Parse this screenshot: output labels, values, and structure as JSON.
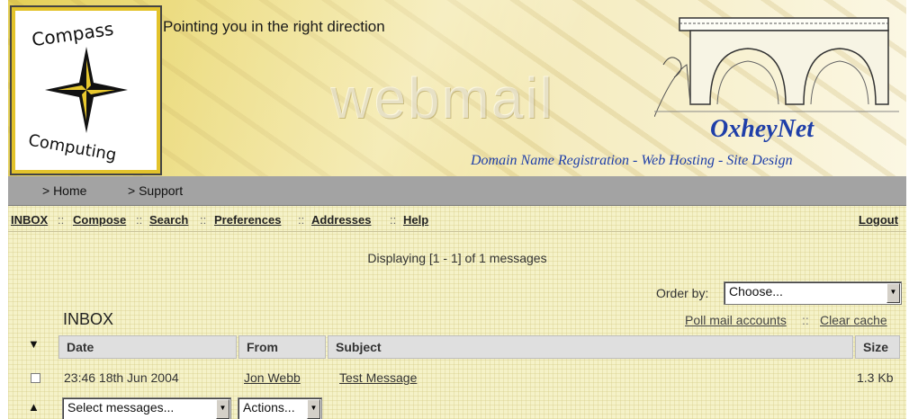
{
  "header": {
    "logo_line1": "Compass",
    "logo_line2": "Computing",
    "tagline": "Pointing you in the right direction",
    "watermark": "webmail",
    "brand_name": "OxheyNet",
    "brand_services": "Domain Name Registration - Web Hosting - Site Design",
    "colors": {
      "banner": "#e9d770",
      "brand_blue": "#1f3fa8",
      "logo_border": "#e3c32b"
    }
  },
  "topnav": {
    "items": [
      "> Home",
      "> Support"
    ]
  },
  "menu": {
    "items": [
      "INBOX",
      "Compose",
      "Search",
      "Preferences",
      "Addresses",
      "Help"
    ],
    "separator": "::",
    "logout": "Logout"
  },
  "mailbox": {
    "status": "Displaying [1 - 1] of 1 messages",
    "order_label": "Order by:",
    "order_value": "Choose...",
    "title": "INBOX",
    "poll_link": "Poll mail accounts",
    "clear_cache_link": "Clear cache",
    "separator": "::",
    "sort_icon_top": "▼",
    "sort_icon_bottom": "▲",
    "columns": [
      "Date",
      "From",
      "Subject",
      "Size"
    ],
    "messages": [
      {
        "date": "23:46 18th Jun 2004",
        "from": "Jon Webb",
        "subject": "Test Message",
        "size": "1.3 Kb",
        "selected": false
      }
    ],
    "select_messages": "Select messages...",
    "actions": "Actions..."
  }
}
